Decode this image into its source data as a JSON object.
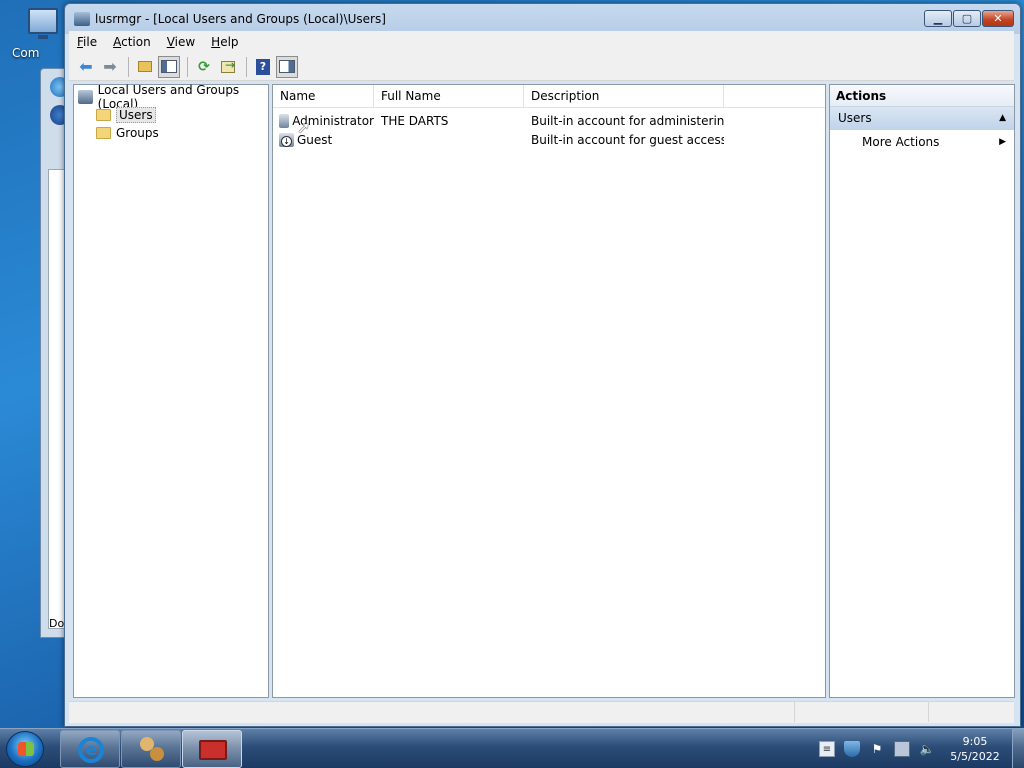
{
  "desktop": {
    "icon_label": "Com"
  },
  "back_window": {
    "status_text": "Do"
  },
  "window": {
    "title": "lusrmgr - [Local Users and Groups (Local)\\Users]",
    "buttons": {
      "minimize": "▁",
      "maximize": "▢",
      "close": "✕"
    }
  },
  "menu": {
    "items": [
      {
        "label": "File",
        "accel": "F",
        "rest": "ile"
      },
      {
        "label": "Action",
        "accel": "A",
        "rest": "ction"
      },
      {
        "label": "View",
        "accel": "V",
        "rest": "iew"
      },
      {
        "label": "Help",
        "accel": "H",
        "rest": "elp"
      }
    ]
  },
  "toolbar": {
    "icons": [
      "back-arrow-icon",
      "forward-arrow-icon",
      "up-folder-icon",
      "show-hide-tree-icon",
      "refresh-icon",
      "export-list-icon",
      "help-icon",
      "show-hide-action-pane-icon"
    ]
  },
  "tree": {
    "root": "Local Users and Groups (Local)",
    "users": "Users",
    "groups": "Groups"
  },
  "list": {
    "columns": [
      "Name",
      "Full Name",
      "Description"
    ],
    "rows": [
      {
        "name": "Administrator",
        "full_name": "THE DARTS",
        "description": "Built-in account for administering..."
      },
      {
        "name": "Guest",
        "full_name": "",
        "description": "Built-in account for guest access t..."
      }
    ]
  },
  "actions": {
    "title": "Actions",
    "section": "Users",
    "items": [
      "More Actions"
    ]
  },
  "taskbar": {
    "ie_letter": "e",
    "clock_time": "9:05",
    "clock_date": "5/5/2022"
  }
}
